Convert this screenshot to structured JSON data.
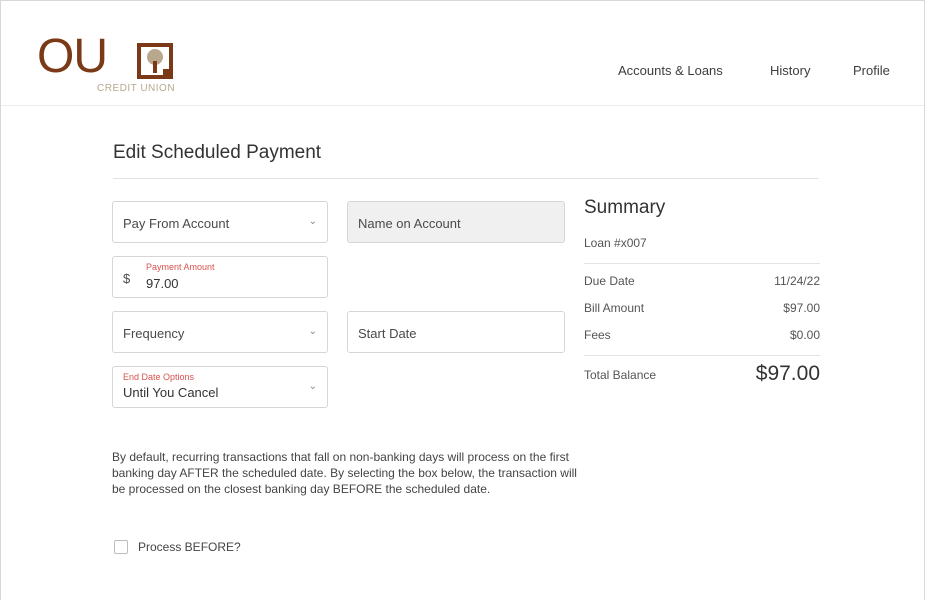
{
  "brand": {
    "logo_text": "OU",
    "subtitle": "CREDIT UNION",
    "colors": {
      "primary": "#7a3a17",
      "secondary": "#b9a88e"
    }
  },
  "nav": {
    "items": [
      "Accounts & Loans",
      "History",
      "Profile"
    ]
  },
  "page": {
    "title": "Edit Scheduled Payment"
  },
  "form": {
    "pay_from": {
      "placeholder": "Pay From Account"
    },
    "name_on_account": {
      "placeholder": "Name on Account"
    },
    "payment_amount": {
      "currency": "$",
      "label": "Payment Amount",
      "value": "97.00"
    },
    "frequency": {
      "placeholder": "Frequency"
    },
    "start_date": {
      "placeholder": "Start Date"
    },
    "end_date": {
      "label": "End Date Options",
      "value": "Until You Cancel"
    },
    "notice": "By default, recurring transactions that fall on non-banking days will process on the first banking day AFTER the scheduled date. By selecting the box below, the transaction will be processed on the closest banking day BEFORE the scheduled date.",
    "process_before_label": "Process BEFORE?",
    "process_before_checked": false
  },
  "summary": {
    "title": "Summary",
    "loan": "Loan #x007",
    "rows": [
      {
        "label": "Due Date",
        "value": "11/24/22"
      },
      {
        "label": "Bill Amount",
        "value": "$97.00"
      },
      {
        "label": "Fees",
        "value": "$0.00"
      }
    ],
    "total_label": "Total Balance",
    "total_value": "$97.00"
  },
  "icons": {
    "dropdown": "chevron-down-icon",
    "logo_mark": "tree-logo-icon"
  }
}
